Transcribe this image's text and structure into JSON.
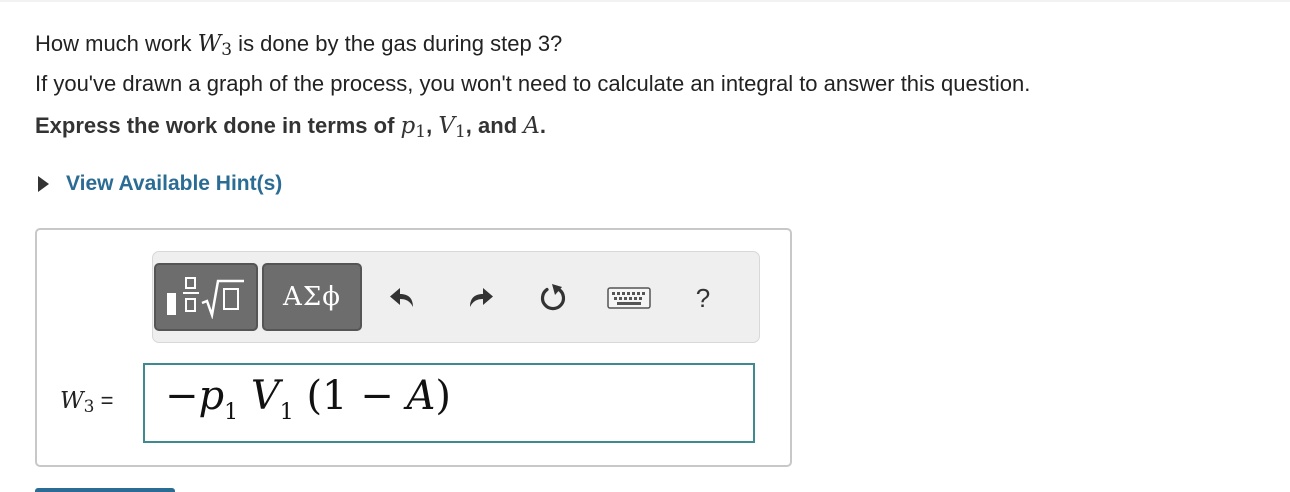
{
  "question": {
    "line1_pre": "How much work ",
    "line1_var": "W",
    "line1_sub": "3",
    "line1_post": " is done by the gas during step 3?",
    "line2": "If you've drawn a graph of the process, you won't need to calculate an integral to answer this question."
  },
  "instruction": {
    "text": "Express the work done in terms of ",
    "p": "p",
    "p_sub": "1",
    "sep1": ", ",
    "v": "V",
    "v_sub": "1",
    "sep2": ", and ",
    "a": "A",
    "end": "."
  },
  "hint": {
    "label": "View Available Hint(s)"
  },
  "toolbar": {
    "templates_icon": "fraction-sqrt-icon",
    "symbols_label": "ΑΣϕ",
    "undo_icon": "undo-icon",
    "redo_icon": "redo-icon",
    "reset_icon": "reset-icon",
    "keyboard_icon": "keyboard-icon",
    "help_label": "?"
  },
  "answer": {
    "label_var": "W",
    "label_sub": "3",
    "label_eq": " =",
    "neg": "−",
    "p": "p",
    "p_sub": "1",
    "v": "V",
    "v_sub": "1",
    "paren": "(1 − ",
    "a": "A",
    "close": ")"
  },
  "colors": {
    "link": "#2b6c94",
    "input_border": "#3f8a91",
    "toolbar_button": "#6d6d6d"
  }
}
